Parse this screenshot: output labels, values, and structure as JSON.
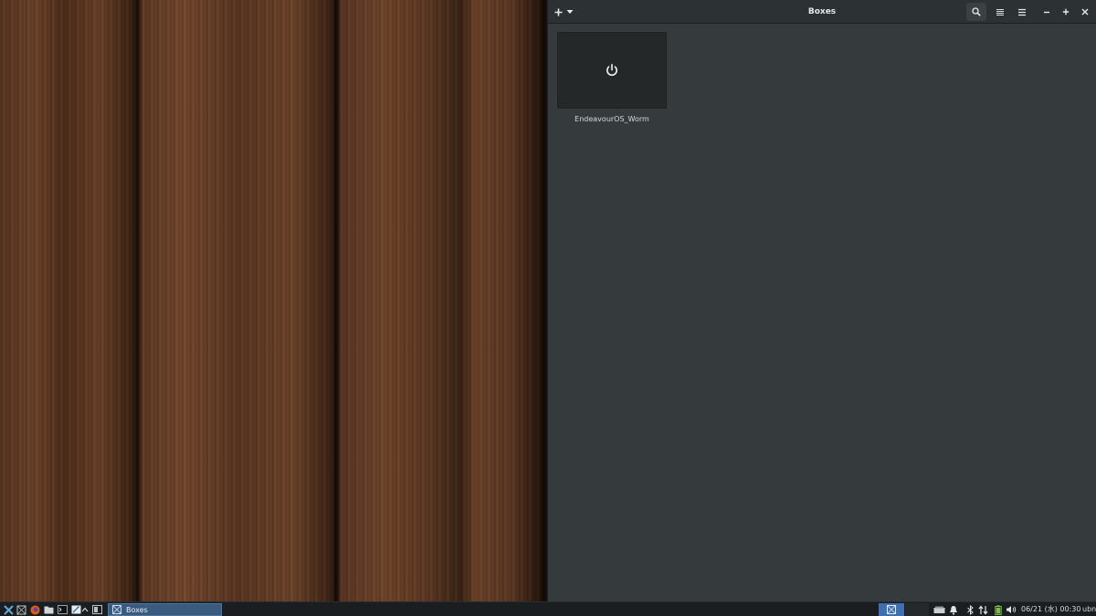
{
  "window": {
    "title": "Boxes",
    "new_button_icon": "plus-icon",
    "new_dropdown_icon": "chevron-down-icon",
    "search_icon": "search-icon",
    "view_icon": "list-view-icon",
    "menu_icon": "hamburger-menu-icon",
    "minimize_icon": "minimize-icon",
    "maximize_icon": "maximize-icon",
    "close_icon": "close-icon"
  },
  "boxes": [
    {
      "name": "EndeavourOS_Worm",
      "icon": "power-icon"
    }
  ],
  "taskbar": {
    "launchers": [
      "xfce-menu-icon",
      "workspace-switcher-icon",
      "firefox-icon",
      "file-manager-icon",
      "terminal-icon",
      "text-editor-icon",
      "show-hidden-icon",
      "show-desktop-icon"
    ],
    "tasks": [
      {
        "label": "Boxes",
        "icon": "boxes-app-icon",
        "active": true
      }
    ],
    "tray": [
      "removable-drive-icon",
      "notifications-icon",
      "bluetooth-icon",
      "network-icon",
      "battery-icon",
      "volume-icon"
    ],
    "clock": "06/21 (水) 00:30",
    "user": "ubn"
  },
  "colors": {
    "window_bg": "#353b3c",
    "titlebar_bg": "#2c3133",
    "thumb_bg": "#252829",
    "taskbar_bg": "#1b1e20",
    "active_task": "#3a5a7e",
    "workspace_active": "#3f6fb0"
  }
}
